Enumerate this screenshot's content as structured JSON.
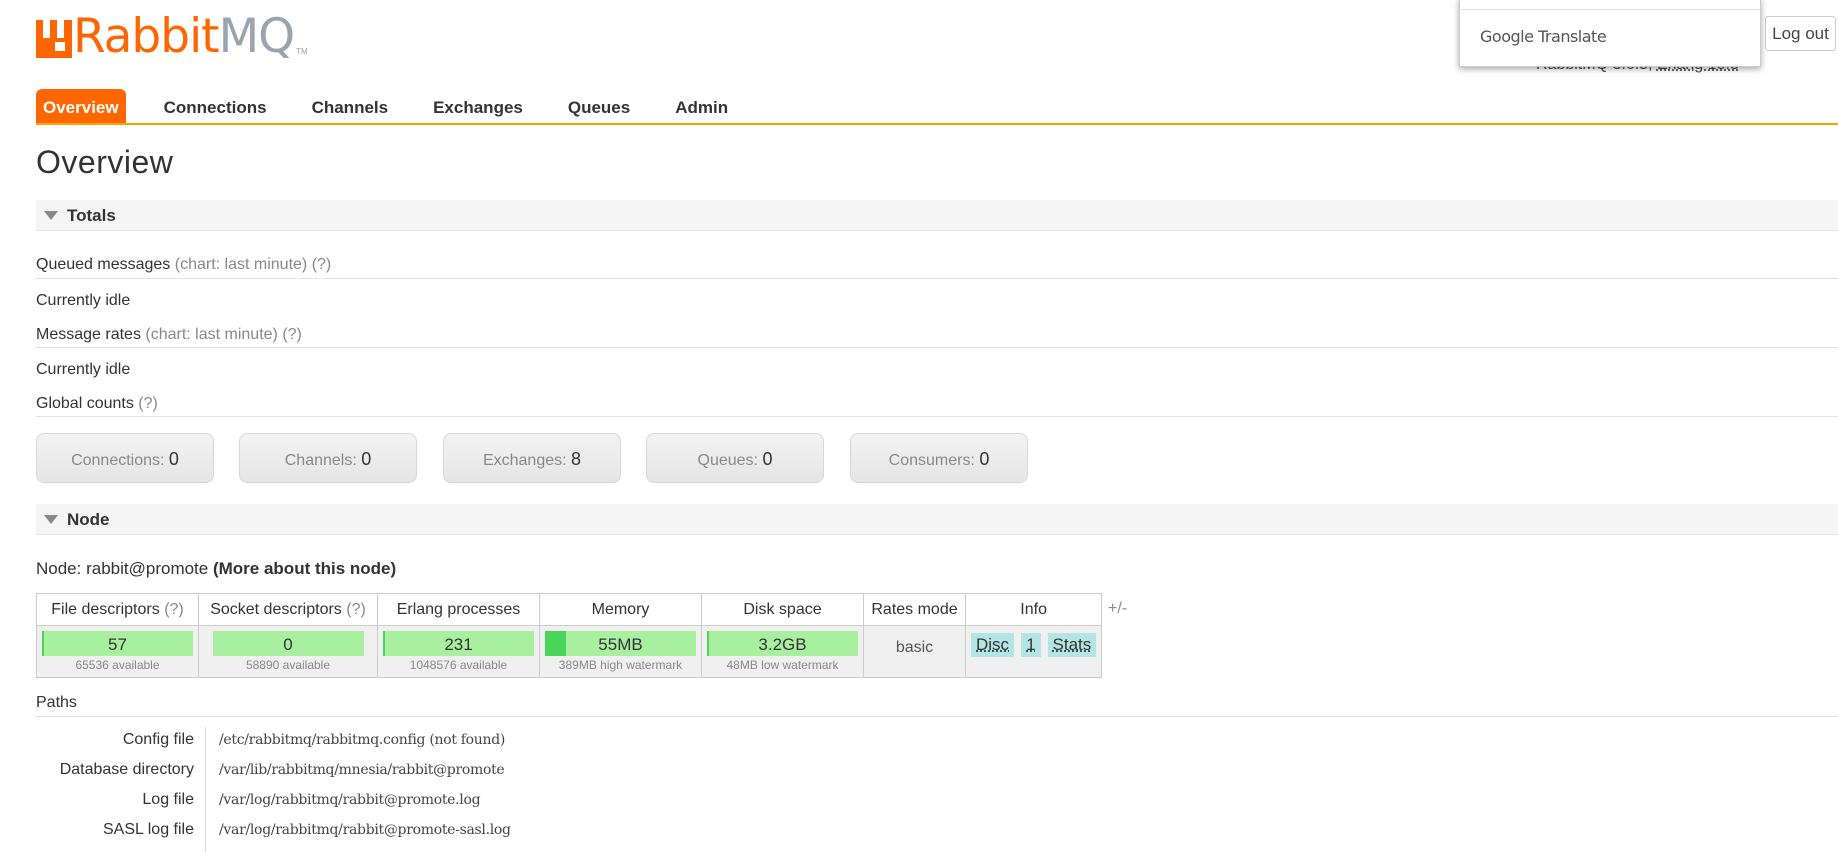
{
  "header": {
    "logo_rabbit": "Rabbit",
    "logo_mq": "MQ",
    "logo_tm": "TM",
    "version_prefix": "RabbitMQ 3.6.5, ",
    "erlang_link": "Erlang 18.3",
    "logout_label": "Log out",
    "google_translate": "Google Translate"
  },
  "tabs": [
    "Overview",
    "Connections",
    "Channels",
    "Exchanges",
    "Queues",
    "Admin"
  ],
  "page_title": "Overview",
  "totals": {
    "heading": "Totals",
    "queued_label": "Queued messages",
    "queued_chart": "(chart: last minute)",
    "help": "(?)",
    "queued_status": "Currently idle",
    "rates_label": "Message rates",
    "rates_chart": "(chart: last minute)",
    "rates_status": "Currently idle",
    "global_label": "Global counts",
    "counts": [
      {
        "label": "Connections:",
        "value": "0"
      },
      {
        "label": "Channels:",
        "value": "0"
      },
      {
        "label": "Exchanges:",
        "value": "8"
      },
      {
        "label": "Queues:",
        "value": "0"
      },
      {
        "label": "Consumers:",
        "value": "0"
      }
    ]
  },
  "node": {
    "heading": "Node",
    "node_prefix": "Node: rabbit@promote",
    "more_link": "(More about this node)",
    "columns": {
      "file": "File descriptors",
      "socket": "Socket descriptors",
      "erlang": "Erlang processes",
      "memory": "Memory",
      "disk": "Disk space",
      "rates": "Rates mode",
      "info": "Info"
    },
    "file": {
      "value": "57",
      "sub": "65536 available",
      "fill": 0.0009
    },
    "socket": {
      "value": "0",
      "sub": "58890 available",
      "fill": 0
    },
    "erlang": {
      "value": "231",
      "sub": "1048576 available",
      "fill": 0.0002
    },
    "memory": {
      "value": "55MB",
      "sub": "389MB high watermark",
      "fill": 0.14
    },
    "disk": {
      "value": "3.2GB",
      "sub": "48MB low watermark",
      "fill": 0.015
    },
    "rates_mode": "basic",
    "info_tags": [
      "Disc",
      "1",
      "Stats"
    ],
    "plus_minus": "+/-"
  },
  "paths": {
    "label": "Paths",
    "rows": [
      {
        "key": "Config file",
        "value": "/etc/rabbitmq/rabbitmq.config (not found)"
      },
      {
        "key": "Database directory",
        "value": "/var/lib/rabbitmq/mnesia/rabbit@promote"
      },
      {
        "key": "Log file",
        "value": "/var/log/rabbitmq/rabbit@promote.log"
      },
      {
        "key": "SASL log file",
        "value": "/var/log/rabbitmq/rabbit@promote-sasl.log"
      }
    ]
  },
  "colors": {
    "brand": "#ff6600",
    "tab_line": "#f7a400",
    "bar": "#a8f0a0",
    "bar_fill": "#4ad45a",
    "tag": "#b4e5e5"
  }
}
